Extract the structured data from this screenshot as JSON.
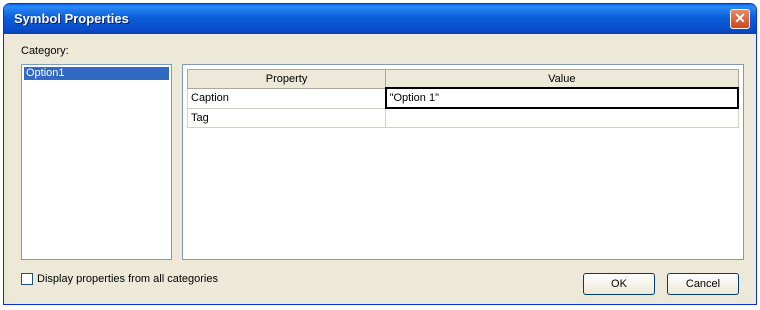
{
  "window": {
    "title": "Symbol Properties",
    "close_glyph": "✕"
  },
  "category": {
    "label": "Category:",
    "items": [
      {
        "label": "Option1",
        "selected": true
      }
    ]
  },
  "grid": {
    "headers": {
      "property": "Property",
      "value": "Value"
    },
    "rows": [
      {
        "property": "Caption",
        "value": "\"Option 1\""
      },
      {
        "property": "Tag",
        "value": ""
      }
    ]
  },
  "display_all": {
    "label": "Display properties from all categories",
    "checked": false
  },
  "buttons": {
    "ok": "OK",
    "cancel": "Cancel"
  },
  "colors": {
    "title_bar": "#0a5fe0",
    "selection": "#316ac5",
    "close": "#d2451f"
  },
  "icons": {
    "close": "close-icon"
  }
}
